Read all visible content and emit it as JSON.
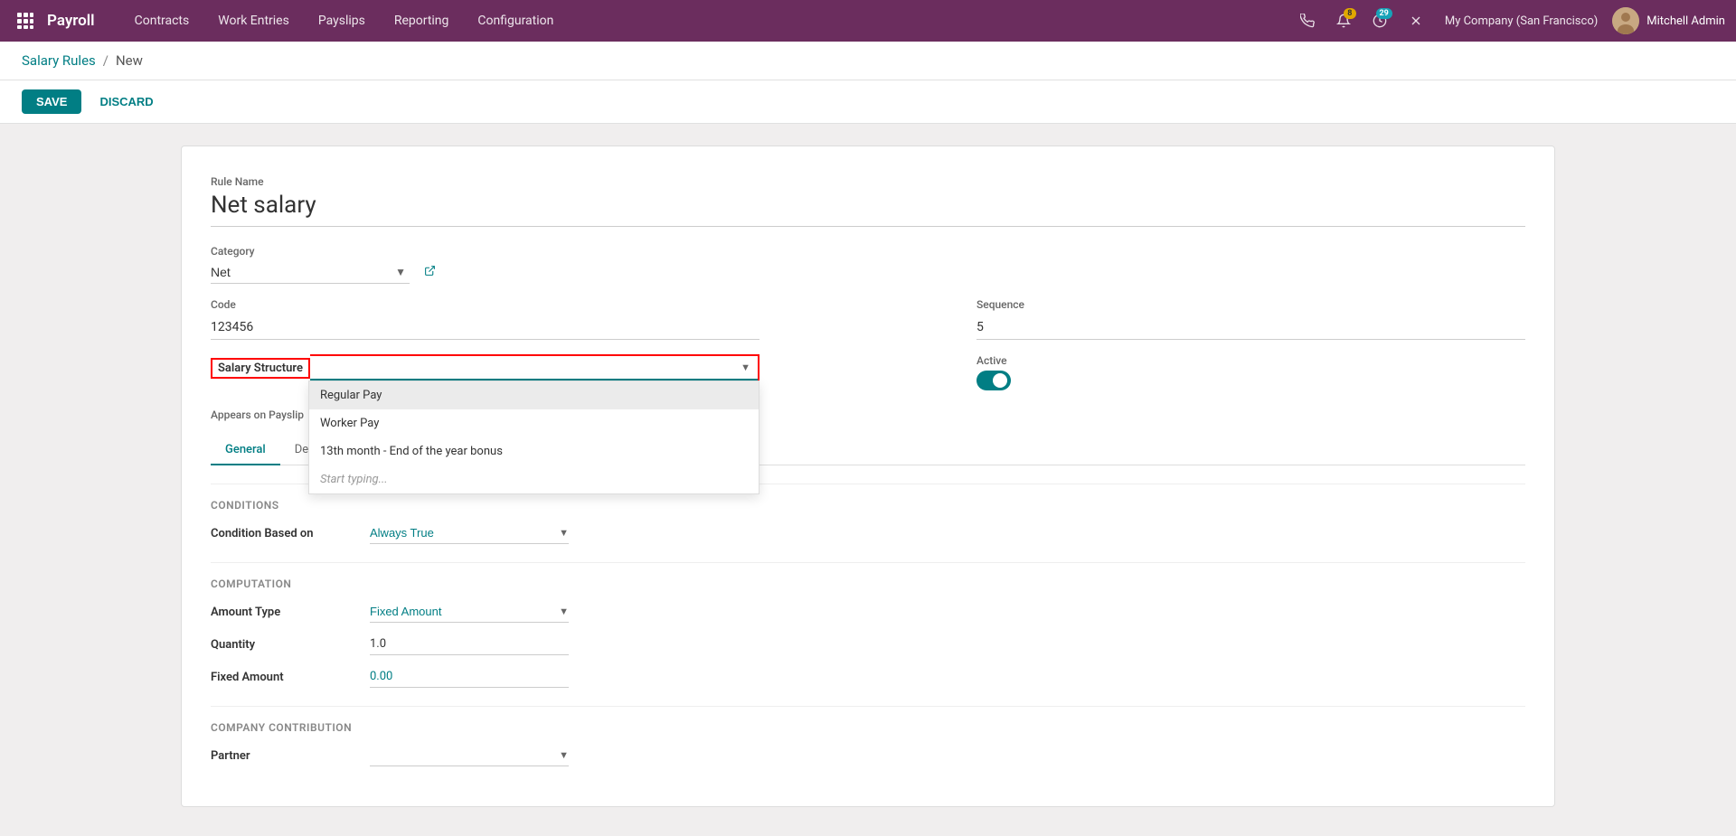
{
  "navbar": {
    "app_label": "Payroll",
    "menu_items": [
      "Contracts",
      "Work Entries",
      "Payslips",
      "Reporting",
      "Configuration"
    ],
    "notification_count": "8",
    "clock_count": "29",
    "company": "My Company (San Francisco)",
    "user_name": "Mitchell Admin"
  },
  "breadcrumb": {
    "parent": "Salary Rules",
    "separator": "/",
    "current": "New"
  },
  "actions": {
    "save_label": "SAVE",
    "discard_label": "DISCARD"
  },
  "form": {
    "rule_name_label": "Rule Name",
    "rule_name_value": "Net salary",
    "category_label": "Category",
    "category_value": "Net",
    "code_label": "Code",
    "code_value": "123456",
    "salary_structure_label": "Salary Structure",
    "salary_structure_input_placeholder": "",
    "sequence_label": "Sequence",
    "sequence_value": "5",
    "active_label": "Active",
    "appears_on_payslip_label": "Appears on Payslip",
    "dropdown_options": [
      "Regular Pay",
      "Worker Pay",
      "13th month - End of the year bonus",
      "Start typing..."
    ],
    "tabs": [
      "General",
      "Description"
    ],
    "conditions_header": "Conditions",
    "condition_based_on_label": "Condition Based on",
    "condition_based_on_value": "Always True",
    "computation_header": "Computation",
    "amount_type_label": "Amount Type",
    "amount_type_value": "Fixed Amount",
    "quantity_label": "Quantity",
    "quantity_value": "1.0",
    "fixed_amount_label": "Fixed Amount",
    "fixed_amount_value": "0.00",
    "company_contribution_header": "Company Contribution",
    "partner_label": "Partner"
  }
}
